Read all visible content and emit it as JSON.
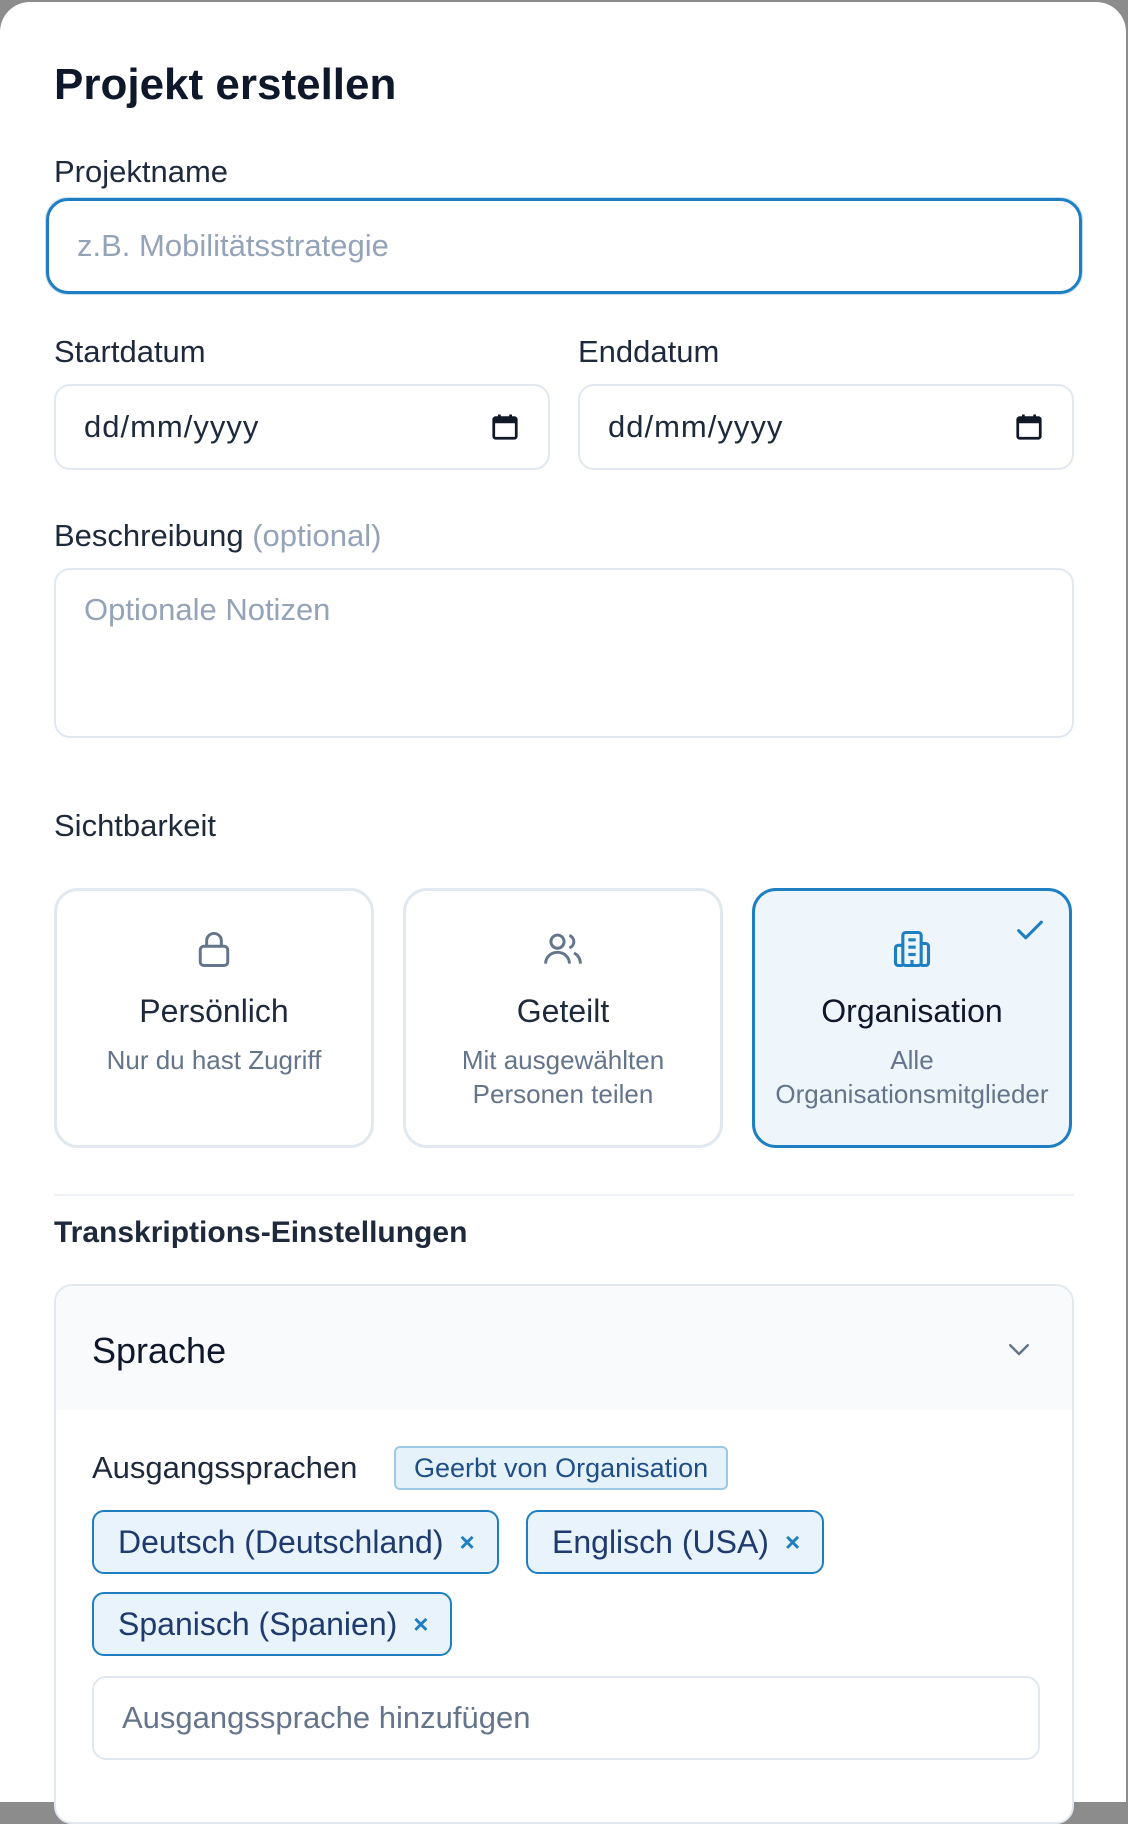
{
  "dialog": {
    "title": "Projekt erstellen"
  },
  "project_name": {
    "label": "Projektname",
    "placeholder": "z.B. Mobilitätsstrategie"
  },
  "start_date": {
    "label": "Startdatum",
    "placeholder": "dd/mm/yyyy",
    "icon": "calendar-icon"
  },
  "end_date": {
    "label": "Enddatum",
    "placeholder": "dd/mm/yyyy",
    "icon": "calendar-icon"
  },
  "description": {
    "label": "Beschreibung",
    "optional_hint": "(optional)",
    "placeholder": "Optionale Notizen"
  },
  "visibility": {
    "label": "Sichtbarkeit",
    "selected": "organisation",
    "options": [
      {
        "id": "personal",
        "icon": "lock-icon",
        "title": "Persönlich",
        "desc_lines": [
          "Nur du hast Zugriff"
        ]
      },
      {
        "id": "shared",
        "icon": "users-icon",
        "title": "Geteilt",
        "desc_lines": [
          "Mit ausgewählten",
          "Personen teilen"
        ]
      },
      {
        "id": "organisation",
        "icon": "building-icon",
        "title": "Organisation",
        "desc_lines": [
          "Alle",
          "Organisationsmitglieder"
        ]
      }
    ]
  },
  "transcription": {
    "title": "Transkriptions-Einstellungen",
    "accordion": {
      "title": "Sprache",
      "expanded": true,
      "source_languages": {
        "label": "Ausgangssprachen",
        "badge": "Geerbt von Organisation",
        "chips": [
          "Deutsch (Deutschland)",
          "Englisch (USA)",
          "Spanisch (Spanien)"
        ],
        "remove_glyph": "×",
        "add_placeholder": "Ausgangssprache hinzufügen"
      }
    }
  },
  "colors": {
    "accent": "#1d7fc1",
    "selected_bg": "#eef6fc",
    "muted": "#94a3b8"
  }
}
